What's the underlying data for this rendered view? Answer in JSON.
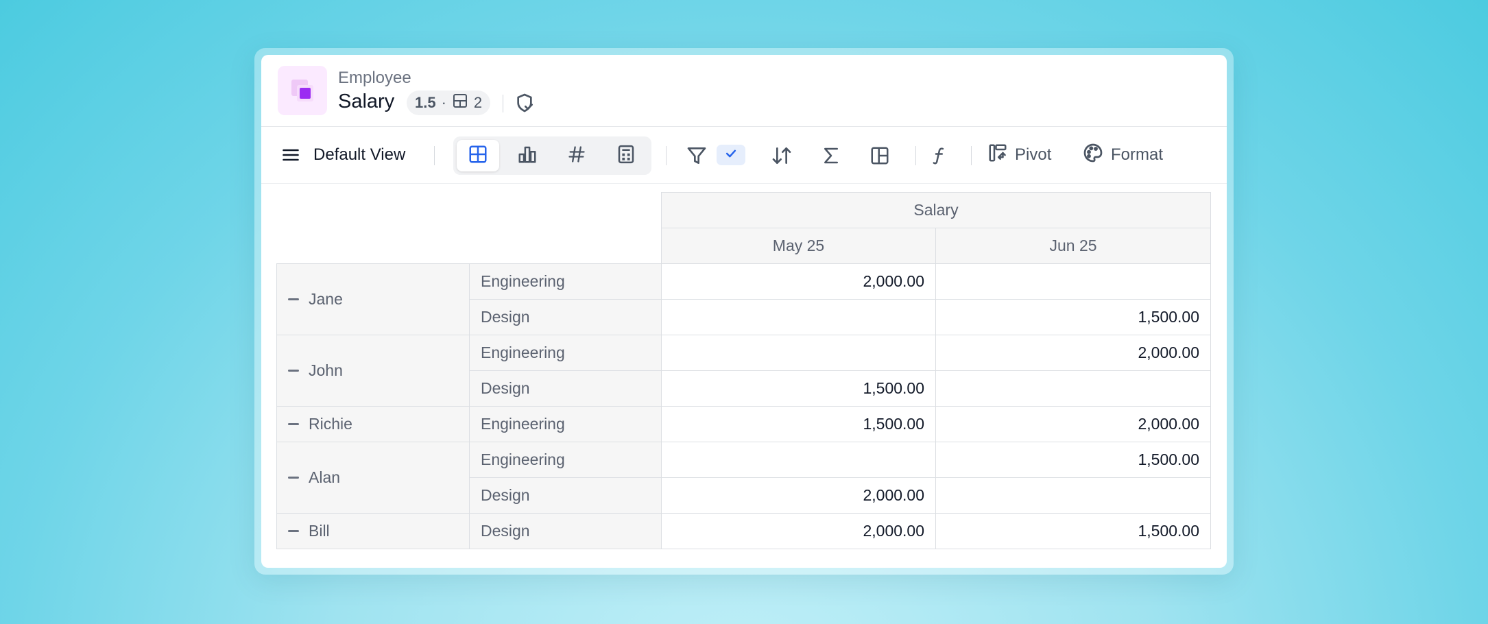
{
  "header": {
    "parent_name": "Employee",
    "title": "Salary",
    "version": "1.5",
    "separator": "·",
    "layout_count": "2",
    "icons": [
      "app-icon",
      "layout-icon",
      "shield-check-icon"
    ]
  },
  "toolbar": {
    "view_name": "Default View",
    "view_types": [
      "table-icon",
      "bar-chart-icon",
      "hash-icon",
      "calculator-icon"
    ],
    "active_view": "table-icon",
    "pivot_label": "Pivot",
    "format_label": "Format",
    "icons": [
      "menu-icon",
      "filter-icon",
      "check-icon",
      "sort-icon",
      "sigma-icon",
      "layout-panels-icon",
      "function-icon",
      "pivot-icon",
      "palette-icon"
    ]
  },
  "table": {
    "measure": "Salary",
    "columns": [
      "May 25",
      "Jun 25"
    ],
    "rows": [
      {
        "name": "Jane",
        "items": [
          {
            "dept": "Engineering",
            "values": [
              "2,000.00",
              ""
            ]
          },
          {
            "dept": "Design",
            "values": [
              "",
              "1,500.00"
            ]
          }
        ]
      },
      {
        "name": "John",
        "items": [
          {
            "dept": "Engineering",
            "values": [
              "",
              "2,000.00"
            ]
          },
          {
            "dept": "Design",
            "values": [
              "1,500.00",
              ""
            ]
          }
        ]
      },
      {
        "name": "Richie",
        "items": [
          {
            "dept": "Engineering",
            "values": [
              "1,500.00",
              "2,000.00"
            ]
          }
        ]
      },
      {
        "name": "Alan",
        "items": [
          {
            "dept": "Engineering",
            "values": [
              "",
              "1,500.00"
            ]
          },
          {
            "dept": "Design",
            "values": [
              "2,000.00",
              ""
            ]
          }
        ]
      },
      {
        "name": "Bill",
        "items": [
          {
            "dept": "Design",
            "values": [
              "2,000.00",
              "1,500.00"
            ]
          }
        ]
      }
    ]
  },
  "colors": {
    "accent": "#2563eb",
    "brand_purple": "#9b2cf2",
    "brand_light": "#fbeaff"
  }
}
